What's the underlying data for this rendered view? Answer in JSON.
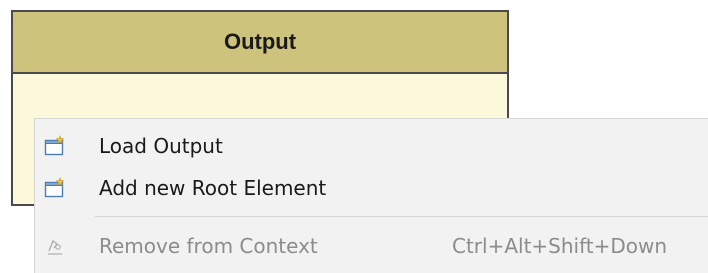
{
  "panel": {
    "title": "Output"
  },
  "context_menu": {
    "items": [
      {
        "label": "Load Output",
        "icon": "new-element-icon",
        "enabled": true
      },
      {
        "label": "Add new Root Element",
        "icon": "new-element-icon",
        "enabled": true
      },
      {
        "label": "Remove from Context",
        "shortcut": "Ctrl+Alt+Shift+Down",
        "icon": "remove-icon",
        "enabled": false
      }
    ]
  },
  "colors": {
    "header_bg": "#cdc37c",
    "panel_bg": "#fcf8dc",
    "menu_bg": "#f2f2f2",
    "disabled_text": "#8c8c8c"
  }
}
